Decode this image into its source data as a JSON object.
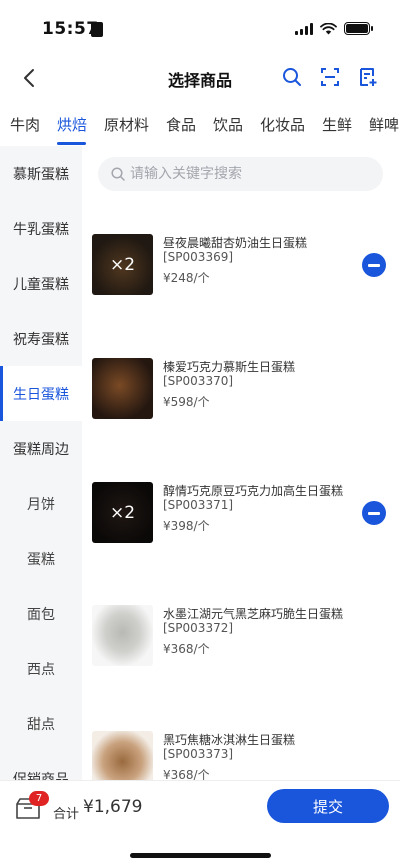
{
  "status": {
    "time": "15:57"
  },
  "nav": {
    "title": "选择商品"
  },
  "categories": [
    {
      "label": "牛肉"
    },
    {
      "label": "烘焙",
      "active": true
    },
    {
      "label": "原材料"
    },
    {
      "label": "食品"
    },
    {
      "label": "饮品"
    },
    {
      "label": "化妆品"
    },
    {
      "label": "生鲜"
    },
    {
      "label": "鲜啤"
    }
  ],
  "sidebar": [
    {
      "label": "慕斯蛋糕"
    },
    {
      "label": "牛乳蛋糕"
    },
    {
      "label": "儿童蛋糕"
    },
    {
      "label": "祝寿蛋糕"
    },
    {
      "label": "生日蛋糕",
      "active": true
    },
    {
      "label": "蛋糕周边"
    },
    {
      "label": "月饼"
    },
    {
      "label": "蛋糕"
    },
    {
      "label": "面包"
    },
    {
      "label": "西点"
    },
    {
      "label": "甜点"
    },
    {
      "label": "促销商品"
    }
  ],
  "search": {
    "placeholder": "请输入关键字搜索"
  },
  "products": [
    {
      "name": "昼夜晨曦甜杏奶油生日蛋糕",
      "code": "[SP003369]",
      "price": "¥248/个",
      "qty": "×2",
      "colors": [
        "#2b2118",
        "#6b4a2a"
      ]
    },
    {
      "name": "榛爱巧克力慕斯生日蛋糕",
      "code": "[SP003370]",
      "price": "¥598/个",
      "qty": "",
      "colors": [
        "#241710",
        "#7a4a25"
      ]
    },
    {
      "name": "醇情巧克原豆巧克力加高生日蛋糕",
      "code": "[SP003371]",
      "price": "¥398/个",
      "qty": "×2",
      "colors": [
        "#0f0c0b",
        "#2a1f1a"
      ]
    },
    {
      "name": "水墨江湖元气黑芝麻巧脆生日蛋糕",
      "code": "[SP003372]",
      "price": "¥368/个",
      "qty": "",
      "colors": [
        "#e8e8e6",
        "#b8b8b4"
      ]
    },
    {
      "name": "黑巧焦糖冰淇淋生日蛋糕",
      "code": "[SP003373]",
      "price": "¥368/个",
      "qty": "",
      "colors": [
        "#f3ede6",
        "#9a6a3e"
      ]
    }
  ],
  "footer": {
    "cart_count": "7",
    "total_label": "合计",
    "total_value": "¥1,679",
    "submit_label": "提交"
  },
  "colors": {
    "accent": "#1a56db",
    "badge": "#e02424"
  }
}
